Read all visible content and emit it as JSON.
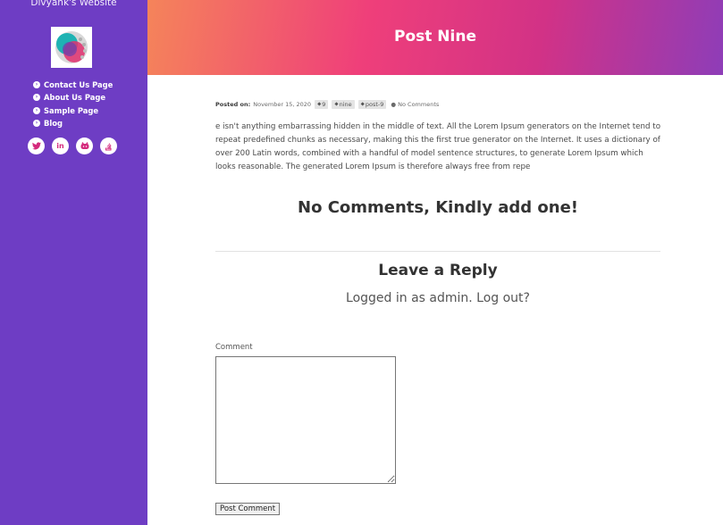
{
  "sidebar": {
    "site_title": "Divyank's Website",
    "nav": [
      {
        "label": "Contact Us Page",
        "icon": "circle-chevron-right-icon"
      },
      {
        "label": "About Us Page",
        "icon": "circle-chevron-right-icon"
      },
      {
        "label": "Sample Page",
        "icon": "circle-chevron-right-icon"
      },
      {
        "label": "Blog",
        "icon": "circle-chevron-right-icon"
      }
    ],
    "social": [
      {
        "name": "twitter-icon",
        "glyph": "🐦"
      },
      {
        "name": "linkedin-icon",
        "glyph": "in"
      },
      {
        "name": "github-icon",
        "glyph": "⌂"
      },
      {
        "name": "stack-overflow-icon",
        "glyph": "≡"
      }
    ],
    "color": "#6e3dc4"
  },
  "post": {
    "title": "Post Nine",
    "meta": {
      "posted_on_label": "Posted on:",
      "date": "November 15, 2020",
      "tags": [
        "9",
        "nine",
        "post-9"
      ],
      "comments": "No Comments"
    },
    "body": "e isn't anything embarrassing hidden in the middle of text. All the Lorem Ipsum generators on the Internet tend to repeat predefined chunks as necessary, making this the first true generator on the Internet. It uses a dictionary of over 200 Latin words, combined with a handful of model sentence structures, to generate Lorem Ipsum which looks reasonable. The generated Lorem Ipsum is therefore always free from repe"
  },
  "comments": {
    "none_message": "No Comments, Kindly add one!",
    "reply_heading": "Leave a Reply",
    "logged_in": "Logged in as admin. Log out?",
    "comment_label": "Comment",
    "comment_value": "",
    "submit_label": "Post Comment"
  }
}
